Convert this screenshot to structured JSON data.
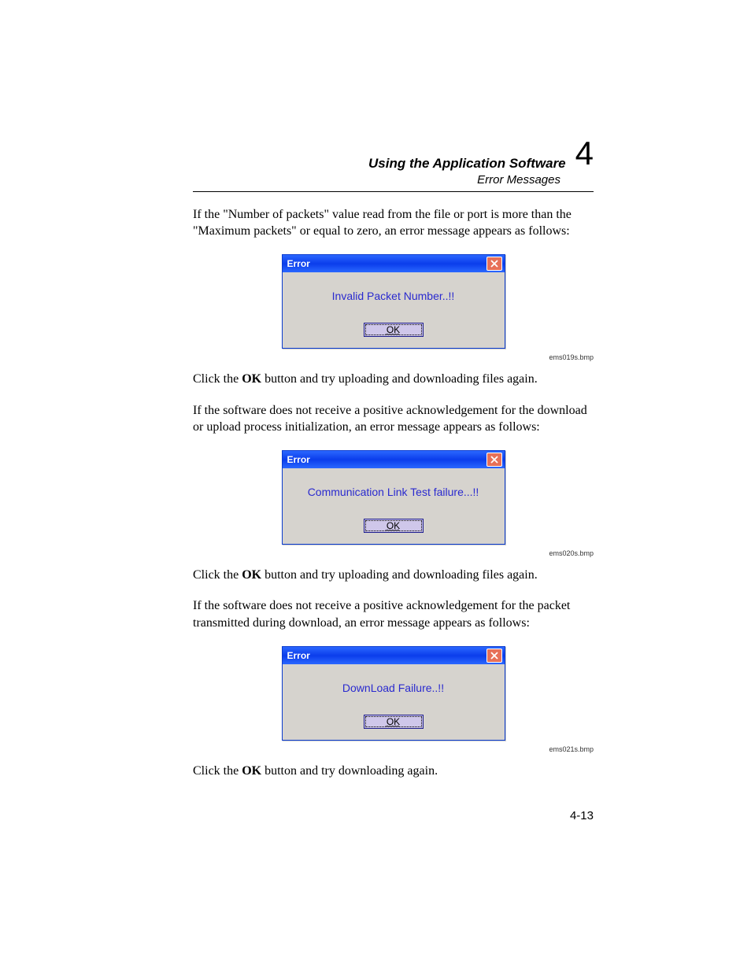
{
  "header": {
    "title": "Using the Application Software",
    "subtitle": "Error Messages",
    "chapter": "4"
  },
  "para1_a": "If the \"Number of packets\" value read from the file or port is more than the \"Maximum packets\" or equal to zero, an error message appears as follows:",
  "dialog1": {
    "title": "Error",
    "message": "Invalid Packet Number..!!",
    "ok": "OK",
    "caption": "ems019s.bmp"
  },
  "para2_a": "Click the ",
  "para2_b": "OK",
  "para2_c": " button and try uploading and downloading files again.",
  "para3": "If the software does not receive a positive acknowledgement for the download or upload process initialization, an error message appears as follows:",
  "dialog2": {
    "title": "Error",
    "message": "Communication Link Test failure...!!",
    "ok": "OK",
    "caption": "ems020s.bmp"
  },
  "para4_a": "Click the ",
  "para4_b": "OK",
  "para4_c": " button and try uploading and downloading files again.",
  "para5": "If the software does not receive a positive acknowledgement for the packet transmitted during download, an error message appears as follows:",
  "dialog3": {
    "title": "Error",
    "message": "DownLoad Failure..!!",
    "ok": "OK",
    "caption": "ems021s.bmp"
  },
  "para6_a": "Click the ",
  "para6_b": "OK",
  "para6_c": " button and try downloading again.",
  "page_number": "4-13"
}
